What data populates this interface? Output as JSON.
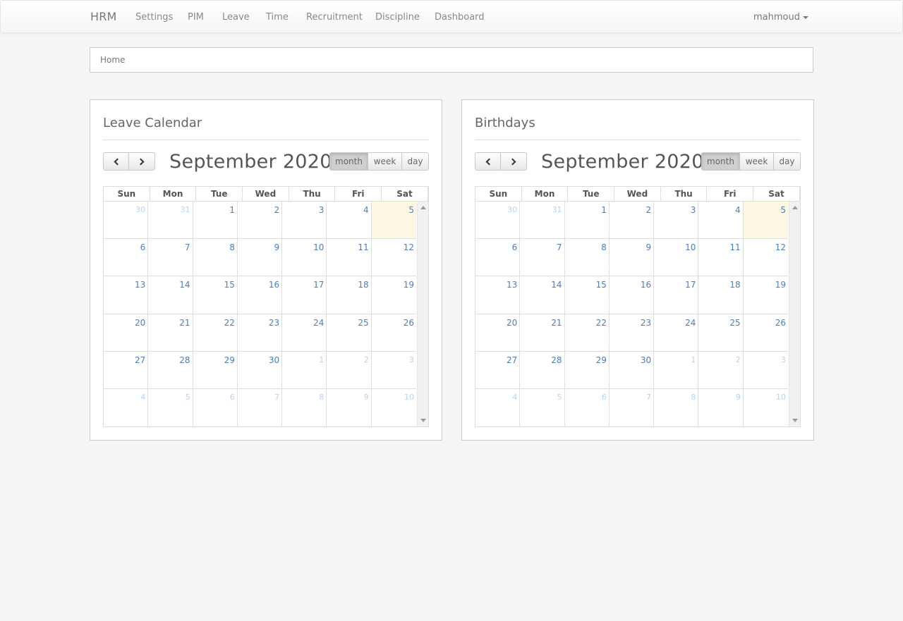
{
  "navbar": {
    "brand": "HRM",
    "items": [
      {
        "label": "Settings"
      },
      {
        "label": "PIM"
      },
      {
        "label": "Leave"
      },
      {
        "label": "Time"
      },
      {
        "label": "Recruitment"
      },
      {
        "label": "Discipline"
      },
      {
        "label": "Dashboard"
      }
    ],
    "user": "mahmoud"
  },
  "breadcrumb": {
    "home": "Home"
  },
  "panels": [
    {
      "title": "Leave Calendar",
      "calendar_title": "September 2020",
      "views": [
        "month",
        "week",
        "day"
      ],
      "active_view": "month"
    },
    {
      "title": "Birthdays",
      "calendar_title": "September 2020",
      "views": [
        "month",
        "week",
        "day"
      ],
      "active_view": "month"
    }
  ],
  "calendar": {
    "weekdays": [
      "Sun",
      "Mon",
      "Tue",
      "Wed",
      "Thu",
      "Fri",
      "Sat"
    ],
    "weeks": [
      [
        "30",
        "31",
        "1",
        "2",
        "3",
        "4",
        "5"
      ],
      [
        "6",
        "7",
        "8",
        "9",
        "10",
        "11",
        "12"
      ],
      [
        "13",
        "14",
        "15",
        "16",
        "17",
        "18",
        "19"
      ],
      [
        "20",
        "21",
        "22",
        "23",
        "24",
        "25",
        "26"
      ],
      [
        "27",
        "28",
        "29",
        "30",
        "1",
        "2",
        "3"
      ],
      [
        "4",
        "5",
        "6",
        "7",
        "8",
        "9",
        "10"
      ]
    ],
    "today": "5"
  },
  "colors": {
    "link": "#4a7ec0",
    "other_month": "#b9d3ed",
    "today_bg": "#fcf8e3"
  }
}
